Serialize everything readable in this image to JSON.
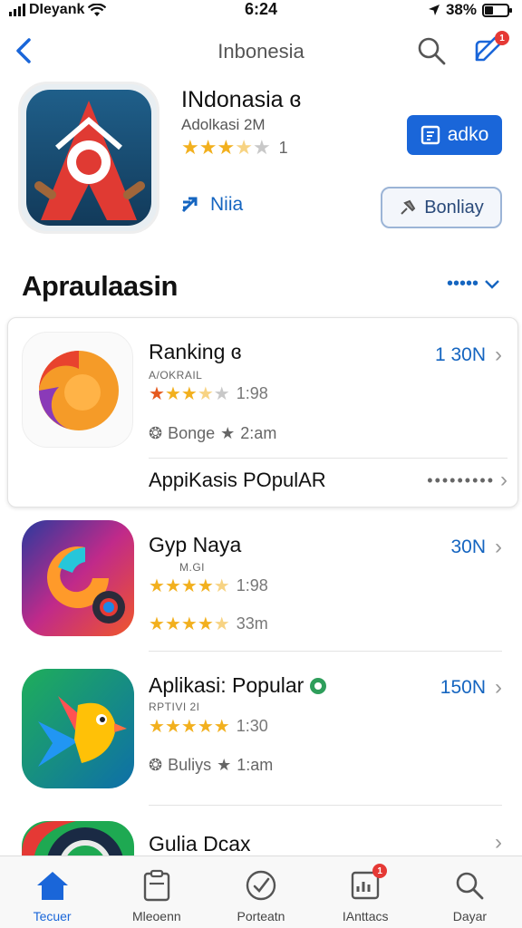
{
  "status_bar": {
    "carrier": "DIeyank",
    "time": "6:24",
    "battery": "38%",
    "battery_level": 0.38
  },
  "nav": {
    "title": "Inbonesia",
    "compose_badge": "1"
  },
  "hero": {
    "app_name": "INdonasia ɞ",
    "subtitle": "Adolkasi 2M",
    "rating": 3.5,
    "rating_count": "1",
    "link_label": "Niia",
    "primary_button": "adko",
    "secondary_button": "Bonliay",
    "icon": "compass-pin-icon"
  },
  "section": {
    "title": "Apraulaasin",
    "more_label": "•••••"
  },
  "apps": [
    {
      "name": "Ranking ɞ",
      "tag": "A/OKRAIL",
      "rating": 3.5,
      "rating_num": "1:98",
      "meta_a": "Bonge",
      "meta_b": "2:am",
      "size": "1 30N",
      "icon": "orange-swirl-icon"
    },
    {
      "name": "Gyp Naya",
      "tag": "M.GI",
      "rating": 4.5,
      "rating_num": "1:98",
      "meta_b": "33m",
      "size": "30N",
      "icon": "rainbow-swirl-icon"
    },
    {
      "name": "Aplikasi: Popular",
      "tag": "RPTIVI 2I",
      "rating": 5,
      "rating_num": "1:30",
      "meta_a": "Buliys",
      "meta_b": "1:am",
      "size": "150N",
      "icon": "colorful-bird-icon"
    },
    {
      "name": "Gulia Dcax",
      "icon": "green-ring-icon"
    }
  ],
  "popular_row": {
    "label": "AppiKasis POpulAR",
    "dots": "•••••••••"
  },
  "tabs": [
    {
      "label": "Tecuer",
      "icon": "home-icon",
      "active": true
    },
    {
      "label": "Mleoenn",
      "icon": "clipboard-icon"
    },
    {
      "label": "Porteatn",
      "icon": "check-circle-icon"
    },
    {
      "label": "IAnttacs",
      "icon": "chart-icon",
      "badge": "1"
    },
    {
      "label": "Dayar",
      "icon": "search-icon"
    }
  ],
  "colors": {
    "accent": "#1a66d9",
    "link": "#1565c0",
    "star": "#f2b01e",
    "badge": "#e53935"
  }
}
